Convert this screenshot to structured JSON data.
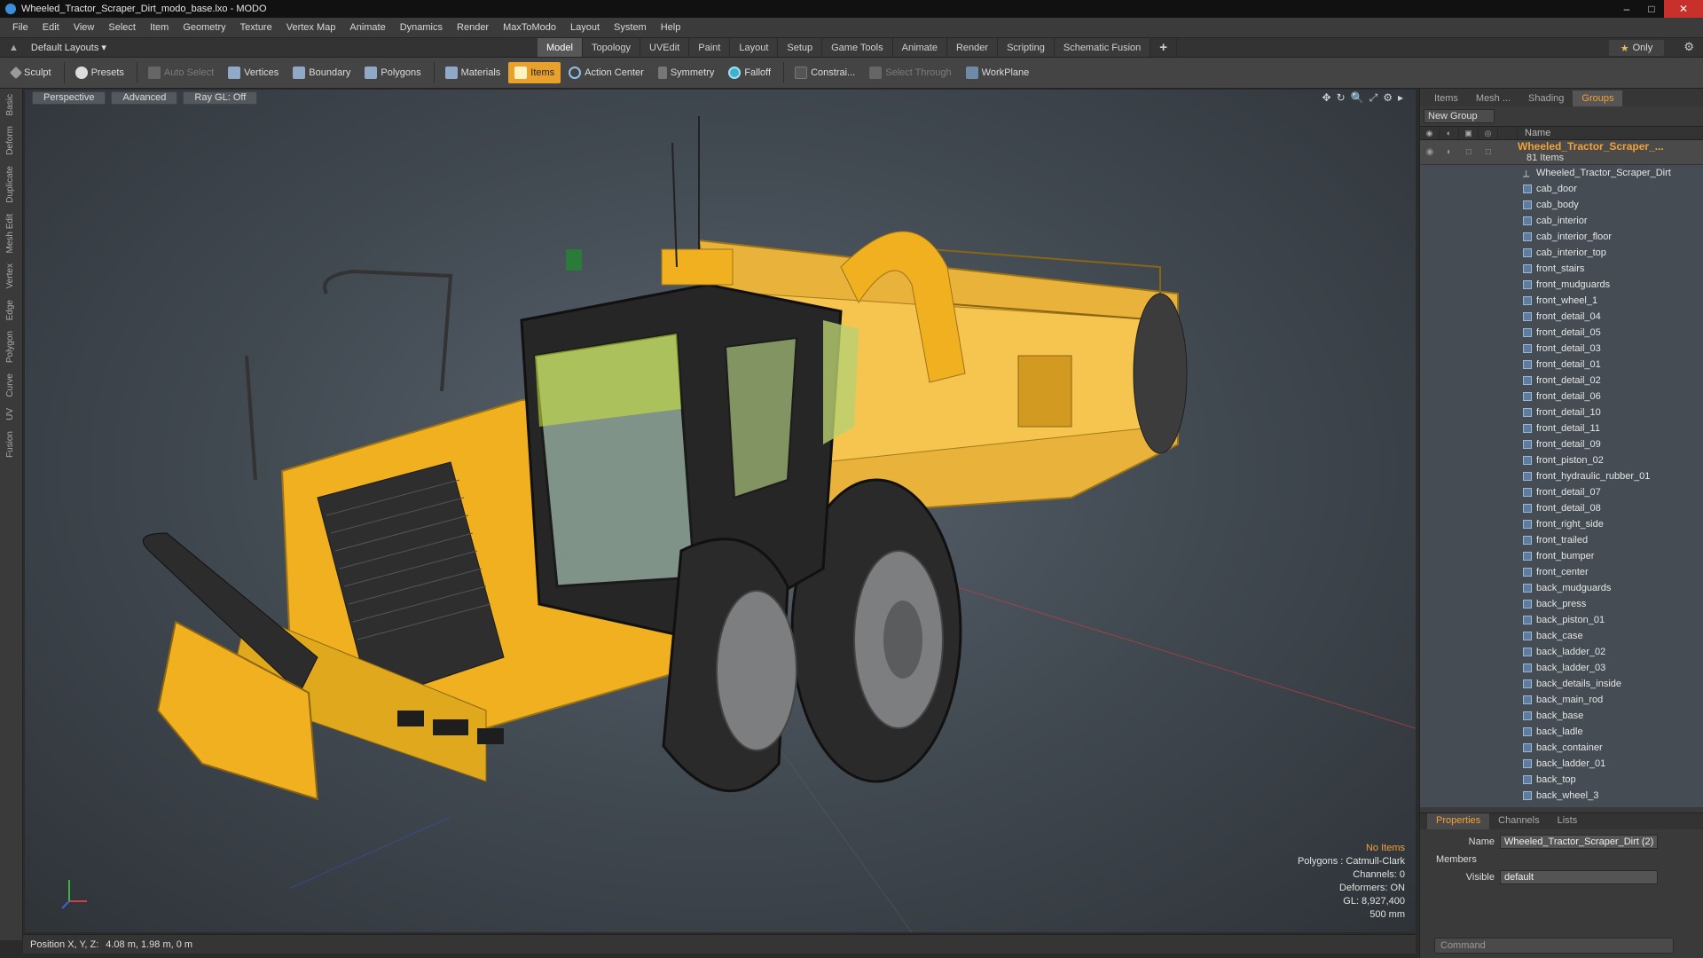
{
  "window": {
    "title": "Wheeled_Tractor_Scraper_Dirt_modo_base.lxo - MODO",
    "controls": [
      "–",
      "□",
      "✕"
    ]
  },
  "menu": [
    "File",
    "Edit",
    "View",
    "Select",
    "Item",
    "Geometry",
    "Texture",
    "Vertex Map",
    "Animate",
    "Dynamics",
    "Render",
    "MaxToModo",
    "Layout",
    "System",
    "Help"
  ],
  "layout_selector": "Default Layouts ▾",
  "mode_tabs": [
    "Model",
    "Topology",
    "UVEdit",
    "Paint",
    "Layout",
    "Setup",
    "Game Tools",
    "Animate",
    "Render",
    "Scripting",
    "Schematic Fusion"
  ],
  "mode_tabs_plus": "+",
  "only_button": "Only",
  "toolbar": {
    "sculpt": "Sculpt",
    "presets": "Presets",
    "auto_select": "Auto Select",
    "vertices": "Vertices",
    "boundary": "Boundary",
    "polygons": "Polygons",
    "materials": "Materials",
    "items": "Items",
    "action_center": "Action Center",
    "symmetry": "Symmetry",
    "falloff": "Falloff",
    "constraints": "Constrai...",
    "select_through": "Select Through",
    "workplane": "WorkPlane"
  },
  "left_strip": [
    "Basic",
    "Deform",
    "Duplicate",
    "Mesh Edit",
    "Vertex",
    "Edge",
    "Polygon",
    "Curve",
    "UV",
    "Fusion"
  ],
  "viewport": {
    "view_mode": "Perspective",
    "shading": "Advanced",
    "raygl": "Ray GL: Off",
    "info": {
      "no_items": "No Items",
      "polygons": "Polygons : Catmull-Clark",
      "channels": "Channels: 0",
      "deformers": "Deformers: ON",
      "gl": "GL: 8,927,400",
      "scale": "500 mm"
    }
  },
  "status": {
    "label": "Position X, Y, Z:",
    "value": "4.08 m, 1.98 m, 0 m"
  },
  "right_panel": {
    "tabs": [
      "Items",
      "Mesh ...",
      "Shading",
      "Groups"
    ],
    "new_group": "New Group",
    "name_header": "Name",
    "group_name": "Wheeled_Tractor_Scraper_...",
    "group_count": "81 Items",
    "items": [
      "Wheeled_Tractor_Scraper_Dirt",
      "cab_door",
      "cab_body",
      "cab_interior",
      "cab_interior_floor",
      "cab_interior_top",
      "front_stairs",
      "front_mudguards",
      "front_wheel_1",
      "front_detail_04",
      "front_detail_05",
      "front_detail_03",
      "front_detail_01",
      "front_detail_02",
      "front_detail_06",
      "front_detail_10",
      "front_detail_11",
      "front_detail_09",
      "front_piston_02",
      "front_hydraulic_rubber_01",
      "front_detail_07",
      "front_detail_08",
      "front_right_side",
      "front_trailed",
      "front_bumper",
      "front_center",
      "back_mudguards",
      "back_press",
      "back_piston_01",
      "back_case",
      "back_ladder_02",
      "back_ladder_03",
      "back_details_inside",
      "back_main_rod",
      "back_base",
      "back_ladle",
      "back_container",
      "back_ladder_01",
      "back_top",
      "back_wheel_3"
    ]
  },
  "properties": {
    "tabs": [
      "Properties",
      "Channels",
      "Lists"
    ],
    "name_label": "Name",
    "name_value": "Wheeled_Tractor_Scraper_Dirt (2)",
    "members_label": "Members",
    "visible_label": "Visible",
    "visible_value": "default"
  },
  "command_placeholder": "Command",
  "colors": {
    "accent": "#f2a23a",
    "tractor_yellow": "#f0b020",
    "viewport_bg": "#4a535b"
  }
}
